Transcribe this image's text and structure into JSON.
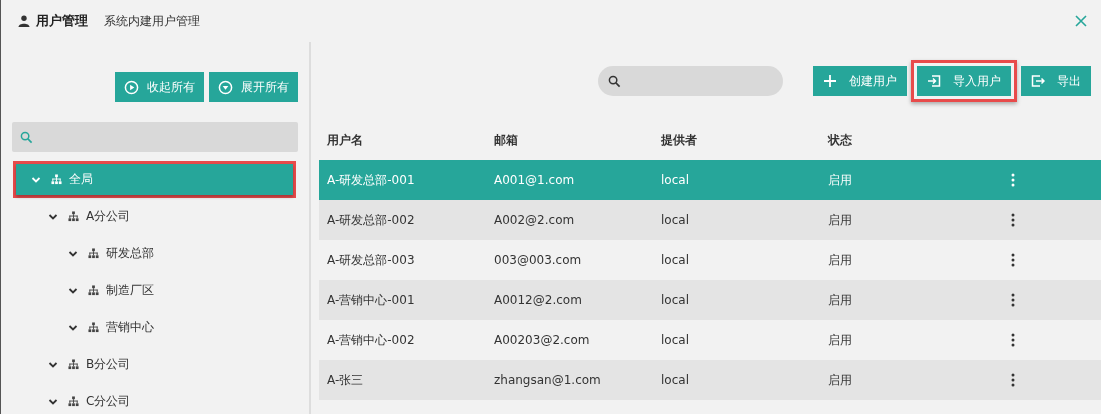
{
  "header": {
    "title": "用户管理",
    "subtitle": "系统内建用户管理"
  },
  "tree_buttons": [
    {
      "kind": "collapse",
      "label": "收起所有"
    },
    {
      "kind": "expand",
      "label": "展开所有"
    }
  ],
  "tree": [
    {
      "label": "全局",
      "selected": true,
      "expanded": true,
      "highlighted": true,
      "children": [
        {
          "label": "A分公司",
          "selected": false,
          "expanded": true,
          "highlighted": false,
          "children": [
            {
              "label": "研发总部",
              "selected": false,
              "expanded": true,
              "highlighted": false
            },
            {
              "label": "制造厂区",
              "selected": false,
              "expanded": true,
              "highlighted": false
            },
            {
              "label": "营销中心",
              "selected": false,
              "expanded": true,
              "highlighted": false
            }
          ]
        },
        {
          "label": "B分公司",
          "selected": false,
          "expanded": true,
          "highlighted": false
        },
        {
          "label": "C分公司",
          "selected": false,
          "expanded": true,
          "highlighted": false
        }
      ]
    }
  ],
  "toolbar": [
    {
      "kind": "create",
      "label": "创建用户",
      "highlighted": false
    },
    {
      "kind": "import",
      "label": "导入用户",
      "highlighted": true
    },
    {
      "kind": "export",
      "label": "导出",
      "highlighted": false
    }
  ],
  "table": {
    "columns": [
      "用户名",
      "邮箱",
      "提供者",
      "状态"
    ],
    "rows": [
      {
        "cells": [
          "A-研发总部-001",
          "A001@1.com",
          "local",
          "启用"
        ],
        "selected": true
      },
      {
        "cells": [
          "A-研发总部-002",
          "A002@2.com",
          "local",
          "启用"
        ],
        "selected": false
      },
      {
        "cells": [
          "A-研发总部-003",
          "003@003.com",
          "local",
          "启用"
        ],
        "selected": false
      },
      {
        "cells": [
          "A-营销中心-001",
          "A0012@2.com",
          "local",
          "启用"
        ],
        "selected": false
      },
      {
        "cells": [
          "A-营销中心-002",
          "A00203@2.com",
          "local",
          "启用"
        ],
        "selected": false
      },
      {
        "cells": [
          "A-张三",
          "zhangsan@1.com",
          "local",
          "启用"
        ],
        "selected": false
      }
    ]
  }
}
